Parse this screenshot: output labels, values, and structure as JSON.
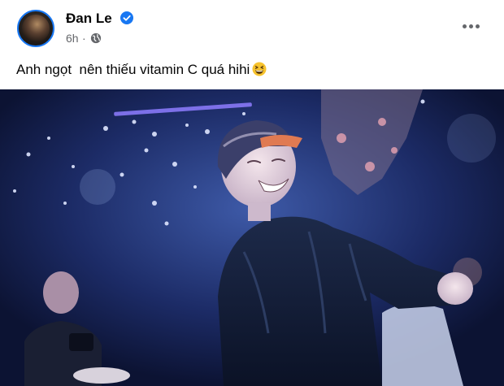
{
  "post": {
    "author": "Đan Le",
    "time": "6h",
    "separator": "·",
    "text": "Anh ngọt  nên thiếu vitamin C quá hihi",
    "icons": {
      "verified": "verified-badge-icon",
      "audience": "globe-icon",
      "more": "more-horizontal-icon",
      "emoji": "grinning-squinting-face-icon"
    },
    "colors": {
      "verified": "#1877f2",
      "secondary_text": "#65676b"
    }
  }
}
